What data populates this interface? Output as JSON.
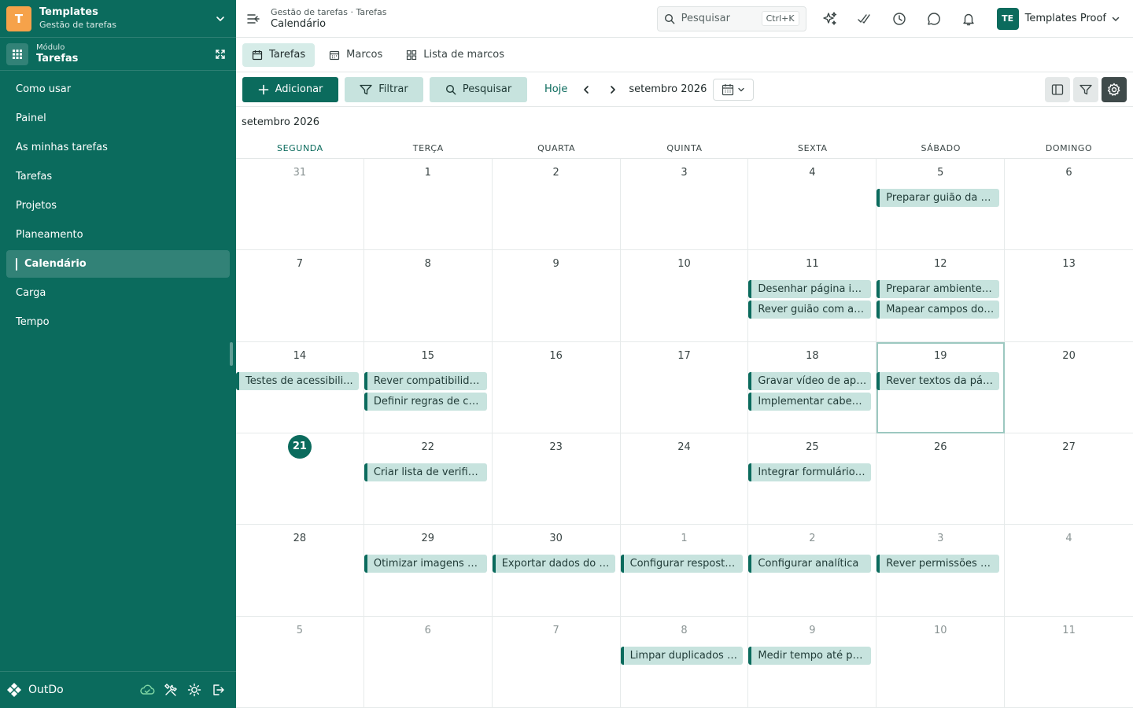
{
  "workspace": {
    "initial": "T",
    "title": "Templates",
    "subtitle": "Gestão de tarefas"
  },
  "module": {
    "label": "Módulo",
    "name": "Tarefas"
  },
  "sidebar": {
    "items": [
      {
        "label": "Como usar",
        "active": false
      },
      {
        "label": "Painel",
        "active": false
      },
      {
        "label": "As minhas tarefas",
        "active": false
      },
      {
        "label": "Tarefas",
        "active": false
      },
      {
        "label": "Projetos",
        "active": false
      },
      {
        "label": "Planeamento",
        "active": false
      },
      {
        "label": "Calendário",
        "active": true
      },
      {
        "label": "Carga",
        "active": false
      },
      {
        "label": "Tempo",
        "active": false
      }
    ]
  },
  "footer": {
    "brand": "OutDo"
  },
  "header": {
    "breadcrumb": "Gestão de tarefas · Tarefas",
    "title": "Calendário",
    "search_placeholder": "Pesquisar",
    "search_shortcut": "Ctrl+K",
    "user_initials": "TE",
    "user_name": "Templates Proof"
  },
  "tabs": [
    {
      "label": "Tarefas",
      "icon": "calendar-icon",
      "active": true
    },
    {
      "label": "Marcos",
      "icon": "calendar-grid-icon",
      "active": false
    },
    {
      "label": "Lista de marcos",
      "icon": "grid-icon",
      "active": false
    }
  ],
  "toolbar": {
    "add_label": "Adicionar",
    "filter_label": "Filtrar",
    "search_label": "Pesquisar",
    "today_label": "Hoje",
    "month_label": "setembro 2026"
  },
  "calendar": {
    "caption": "setembro 2026",
    "weekdays": [
      "SEGUNDA",
      "TERÇA",
      "QUARTA",
      "QUINTA",
      "SEXTA",
      "SÁBADO",
      "DOMINGO"
    ],
    "today_column": 0,
    "colors": {
      "accent": "#0b6b5d",
      "event_bg": "#c7e3de"
    },
    "weeks": [
      [
        {
          "day": "31",
          "muted": true,
          "events": []
        },
        {
          "day": "1",
          "events": []
        },
        {
          "day": "2",
          "events": []
        },
        {
          "day": "3",
          "events": []
        },
        {
          "day": "4",
          "events": []
        },
        {
          "day": "5",
          "events": [
            "Preparar guião da se..."
          ]
        },
        {
          "day": "6",
          "events": []
        }
      ],
      [
        {
          "day": "7",
          "events": []
        },
        {
          "day": "8",
          "events": []
        },
        {
          "day": "9",
          "events": []
        },
        {
          "day": "10",
          "events": []
        },
        {
          "day": "11",
          "events": [
            "Desenhar página ini...",
            "Rever guião com a e..."
          ]
        },
        {
          "day": "12",
          "events": [
            "Preparar ambiente d...",
            "Mapear campos do ..."
          ]
        },
        {
          "day": "13",
          "events": []
        }
      ],
      [
        {
          "day": "14",
          "events": [
            "Testes de acessibili..."
          ]
        },
        {
          "day": "15",
          "events": [
            "Rever compatibilida...",
            "Definir regras de co..."
          ]
        },
        {
          "day": "16",
          "events": []
        },
        {
          "day": "17",
          "events": []
        },
        {
          "day": "18",
          "events": [
            "Gravar vídeo de apr...",
            "Implementar cabeça..."
          ]
        },
        {
          "day": "19",
          "selected": true,
          "events": [
            "Rever textos da pági..."
          ]
        },
        {
          "day": "20",
          "events": []
        }
      ],
      [
        {
          "day": "21",
          "today": true,
          "events": []
        },
        {
          "day": "22",
          "events": [
            "Criar lista de verific..."
          ]
        },
        {
          "day": "23",
          "events": []
        },
        {
          "day": "24",
          "events": []
        },
        {
          "day": "25",
          "events": [
            "Integrar formulário ..."
          ]
        },
        {
          "day": "26",
          "events": []
        },
        {
          "day": "27",
          "events": []
        }
      ],
      [
        {
          "day": "28",
          "events": []
        },
        {
          "day": "29",
          "events": [
            "Otimizar imagens d..."
          ]
        },
        {
          "day": "30",
          "events": [
            "Exportar dados do si..."
          ]
        },
        {
          "day": "1",
          "muted": true,
          "events": [
            "Configurar resposta..."
          ]
        },
        {
          "day": "2",
          "muted": true,
          "events": [
            "Configurar analítica"
          ]
        },
        {
          "day": "3",
          "muted": true,
          "events": [
            "Rever permissões n..."
          ]
        },
        {
          "day": "4",
          "muted": true,
          "events": []
        }
      ],
      [
        {
          "day": "5",
          "muted": true,
          "events": []
        },
        {
          "day": "6",
          "muted": true,
          "events": []
        },
        {
          "day": "7",
          "muted": true,
          "events": []
        },
        {
          "day": "8",
          "muted": true,
          "events": [
            "Limpar duplicados d..."
          ]
        },
        {
          "day": "9",
          "muted": true,
          "events": [
            "Medir tempo até pri..."
          ]
        },
        {
          "day": "10",
          "muted": true,
          "events": []
        },
        {
          "day": "11",
          "muted": true,
          "events": []
        }
      ]
    ]
  }
}
